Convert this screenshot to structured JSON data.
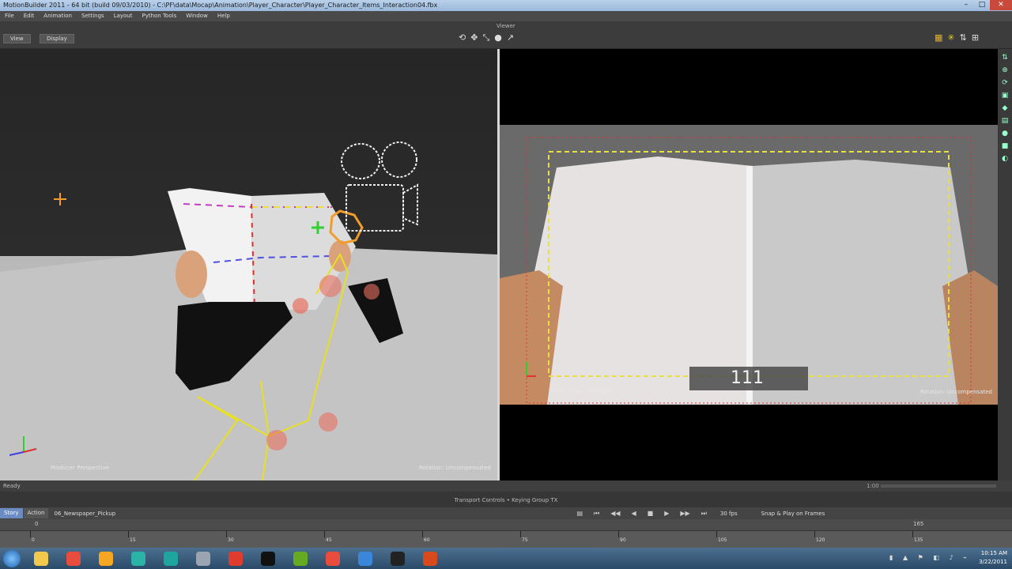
{
  "window": {
    "title": "MotionBuilder 2011 - 64 bit (build 09/03/2010) - C:\\PF\\data\\Mocap\\Animation\\Player_Character\\Player_Character_Items_Interaction04.fbx",
    "buttons": [
      "–",
      "□",
      "✕"
    ]
  },
  "menu": [
    "File",
    "Edit",
    "Animation",
    "Settings",
    "Layout",
    "Python Tools",
    "Window",
    "Help"
  ],
  "toolbar": {
    "view_button": "View",
    "display_button": "Display",
    "viewer_label": "Viewer",
    "tool_icons": [
      "⟲",
      "✥",
      "⤡",
      "●",
      "↗"
    ]
  },
  "viewport_left": {
    "camera_label": "Producer Perspective",
    "mode_label": "Rotation: Uncompensated"
  },
  "viewport_right": {
    "camera_label": "FPF_Camera (Perspective)",
    "mode_label": "Rotation: Uncompensated",
    "frame_counter": "111"
  },
  "status": {
    "text": "Ready",
    "zoom": "1:00"
  },
  "transport_bar_label": "Transport Controls • Keying Group TX",
  "controls": {
    "tabs": [
      "Story",
      "Action"
    ],
    "active_tab": "Story",
    "take_name": "06_Newspaper_Pickup",
    "fps": "30 fps",
    "snap": "Snap & Play on Frames",
    "frame_value": "0"
  },
  "timeline": {
    "labels": [
      "0",
      "15",
      "30",
      "45",
      "60",
      "75",
      "90",
      "105",
      "120",
      "135"
    ],
    "end": "165"
  },
  "taskbar": {
    "time": "10:15 AM",
    "date": "3/22/2011",
    "apps": [
      {
        "name": "explorer-icon",
        "color": "#f2c94c"
      },
      {
        "name": "chrome-icon",
        "color": "#e74c3c"
      },
      {
        "name": "folder-icon",
        "color": "#f5a623"
      },
      {
        "name": "motionbuilder-icon",
        "color": "#2bb3a8"
      },
      {
        "name": "maya-icon",
        "color": "#1fa5a0"
      },
      {
        "name": "calendar-icon",
        "color": "#9aa5b1"
      },
      {
        "name": "vivaldi-icon",
        "color": "#e03b2f"
      },
      {
        "name": "eleven-icon",
        "color": "#111111"
      },
      {
        "name": "greenapp-icon",
        "color": "#66aa22"
      },
      {
        "name": "chrome2-icon",
        "color": "#e74c3c"
      },
      {
        "name": "paint-icon",
        "color": "#3a86d9"
      },
      {
        "name": "obs-icon",
        "color": "#222222"
      },
      {
        "name": "record-icon",
        "color": "#d84a1b"
      }
    ]
  }
}
